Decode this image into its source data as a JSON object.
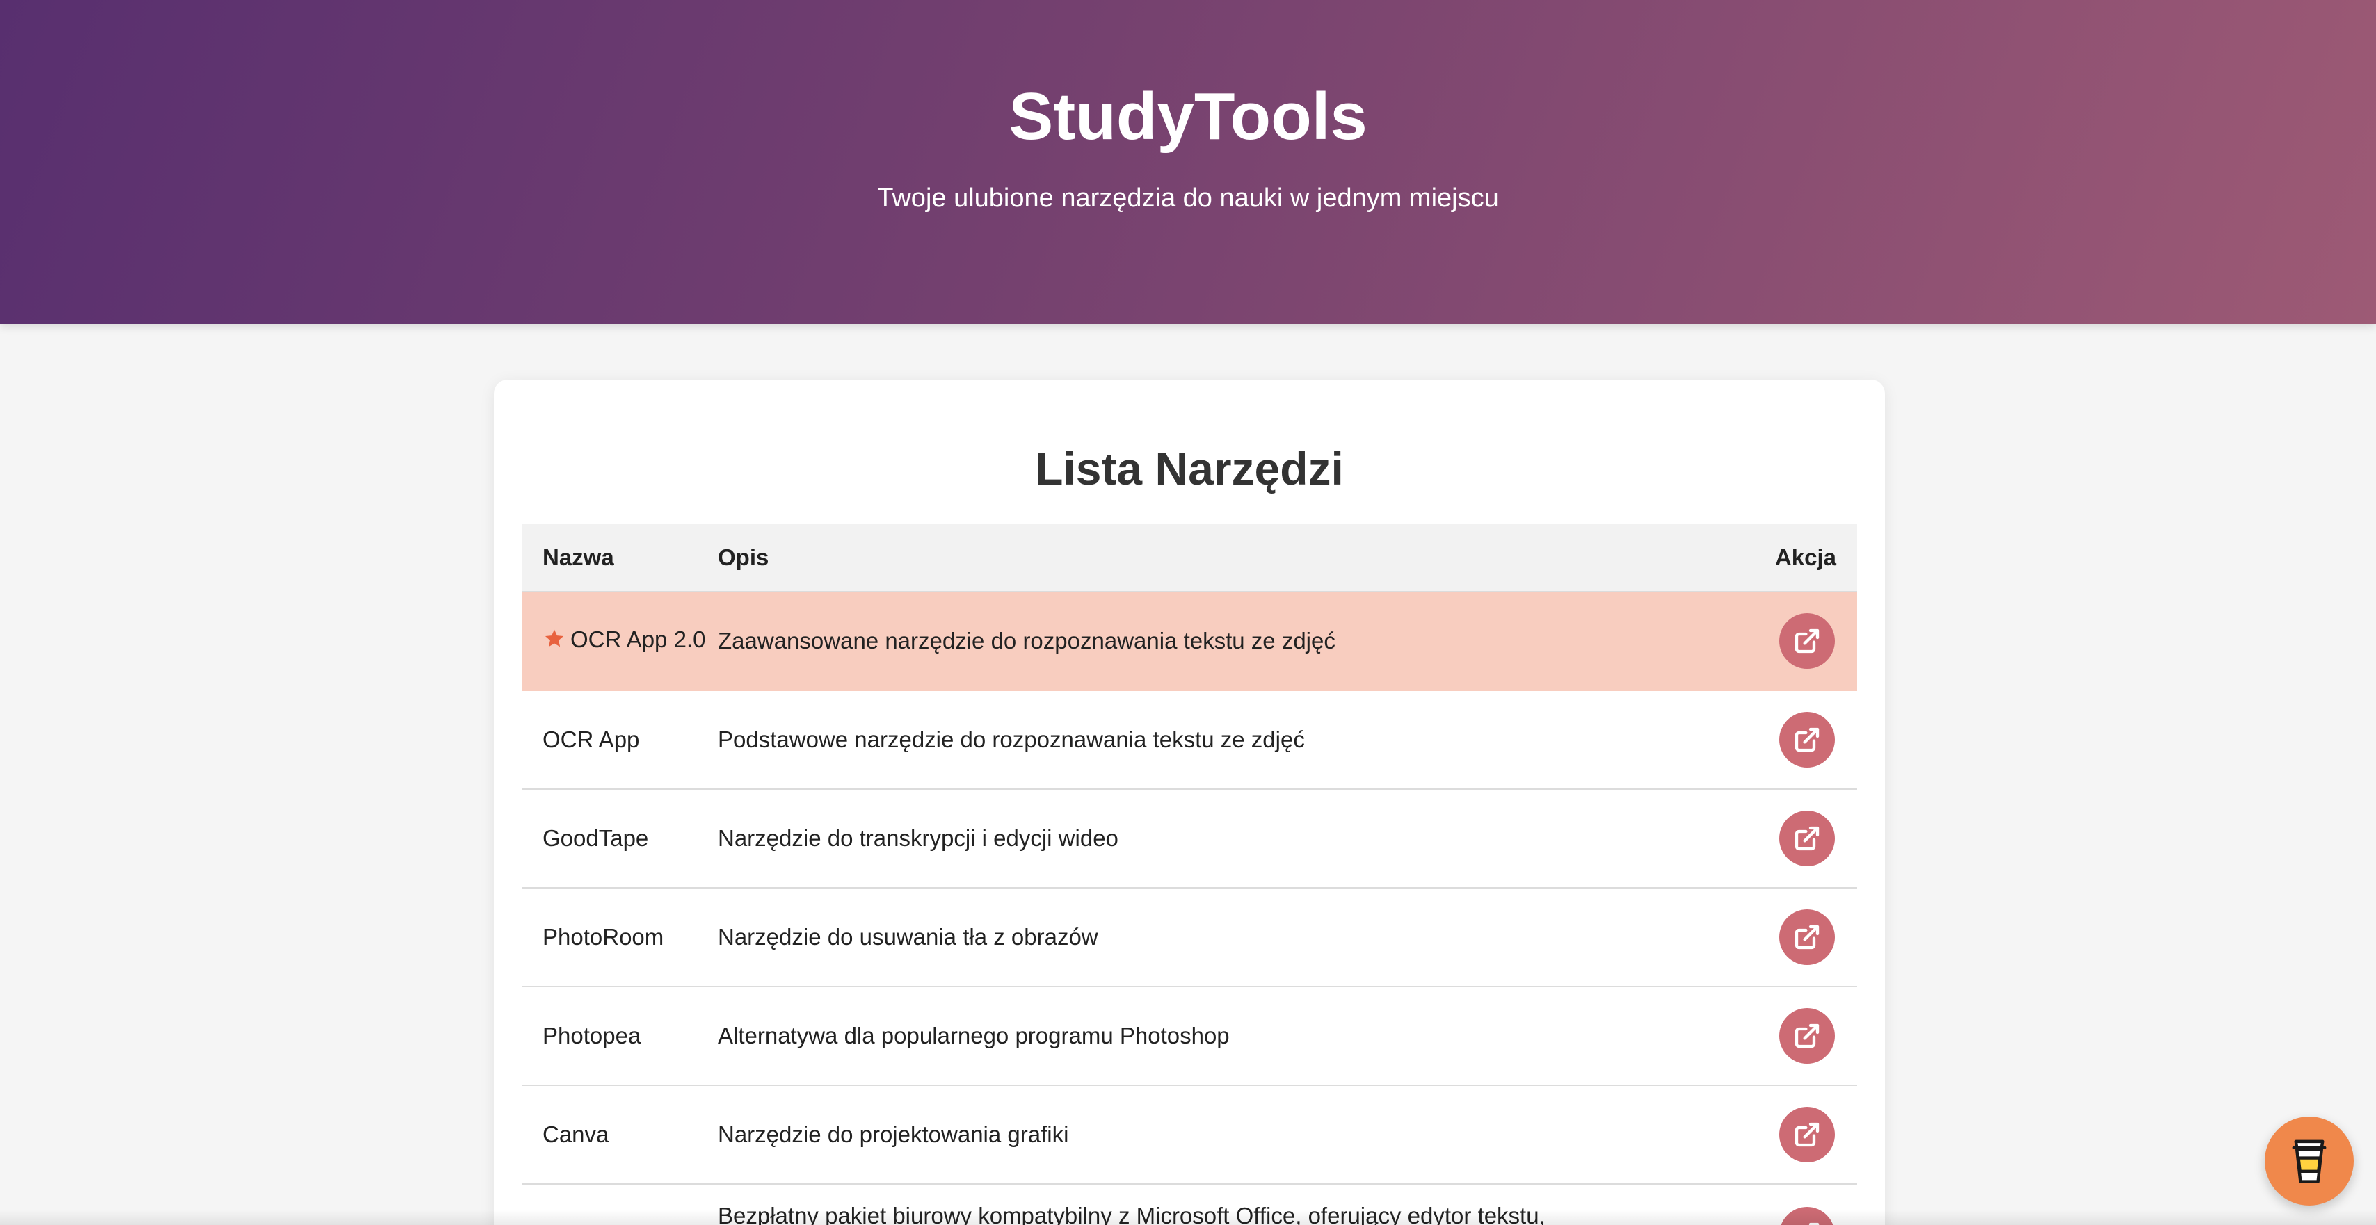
{
  "hero": {
    "title": "StudyTools",
    "subtitle": "Twoje ulubione narzędzia do nauki w jednym miejscu"
  },
  "card": {
    "heading": "Lista Narzędzi",
    "columns": {
      "name": "Nazwa",
      "desc": "Opis",
      "action": "Akcja"
    },
    "rows": [
      {
        "name": "OCR App 2.0",
        "desc": "Zaawansowane narzędzie do rozpoznawania tekstu ze zdjęć",
        "featured": true,
        "action_icon": "external-link-icon"
      },
      {
        "name": "OCR App",
        "desc": "Podstawowe narzędzie do rozpoznawania tekstu ze zdjęć",
        "action_icon": "external-link-icon"
      },
      {
        "name": "GoodTape",
        "desc": "Narzędzie do transkrypcji i edycji wideo",
        "action_icon": "external-link-icon"
      },
      {
        "name": "PhotoRoom",
        "desc": "Narzędzie do usuwania tła z obrazów",
        "action_icon": "external-link-icon"
      },
      {
        "name": "Photopea",
        "desc": "Alternatywa dla popularnego programu Photoshop",
        "action_icon": "external-link-icon"
      },
      {
        "name": "Canva",
        "desc": "Narzędzie do projektowania grafiki",
        "action_icon": "external-link-icon"
      },
      {
        "name": "",
        "desc": "Bezpłatny pakiet biurowy kompatybilny z Microsoft Office, oferujący edytor tekstu, arkusze",
        "action_icon": "external-link-icon"
      }
    ]
  },
  "fab": {
    "icon": "coffee-cup-icon"
  },
  "colors": {
    "hero_start": "#582f6f",
    "hero_end": "#9d5a75",
    "action_button": "#cd6b74",
    "highlight_row": "#f8cdbf",
    "star": "#e8623f",
    "fab": "#f0884b"
  }
}
